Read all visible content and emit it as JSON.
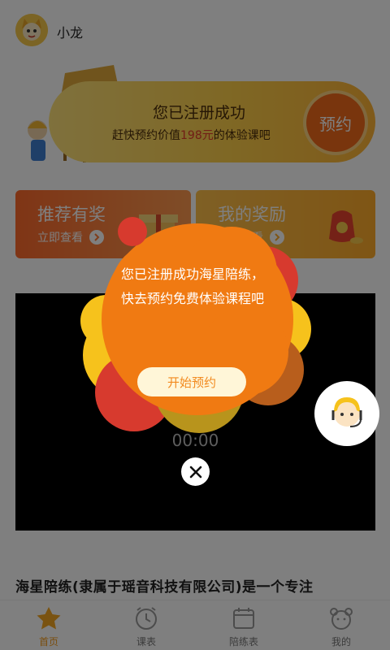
{
  "header": {
    "username": "小龙"
  },
  "banner": {
    "title": "您已注册成功",
    "subtitle_prefix": "赶快预约价值",
    "price": "198元",
    "subtitle_suffix": "的体验课吧",
    "reserve_label": "预约"
  },
  "cards": [
    {
      "title": "推荐有奖",
      "sub": "立即查看"
    },
    {
      "title": "我的奖励",
      "sub": "立即查看"
    }
  ],
  "video": {
    "time": "00:00"
  },
  "intro": {
    "text": "海星陪练(隶属于瑶音科技有限公司)是一个专注"
  },
  "popup": {
    "message": "您已注册成功海星陪练，快去预约免费体验课程吧",
    "button_label": "开始预约"
  },
  "nav": [
    {
      "label": "首页",
      "icon": "star-icon",
      "active": true
    },
    {
      "label": "课表",
      "icon": "clock-icon",
      "active": false
    },
    {
      "label": "陪练表",
      "icon": "calendar-icon",
      "active": false
    },
    {
      "label": "我的",
      "icon": "bear-icon",
      "active": false
    }
  ],
  "colors": {
    "accent": "#f59a1a",
    "popup_orange": "#f07a12",
    "popup_red": "#d73a2e",
    "popup_yellow": "#f6c21c"
  }
}
